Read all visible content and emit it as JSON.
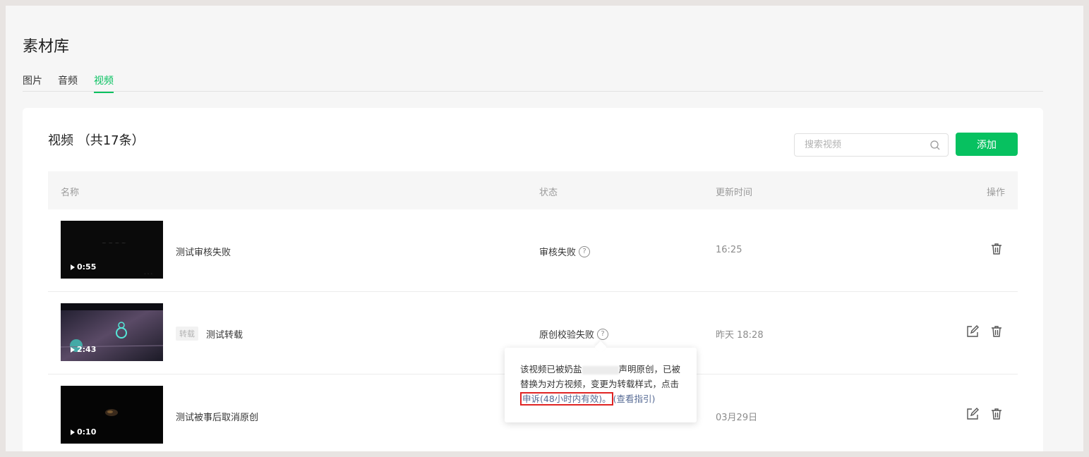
{
  "page": {
    "title": "素材库"
  },
  "tabs": [
    {
      "label": "图片",
      "active": false
    },
    {
      "label": "音频",
      "active": false
    },
    {
      "label": "视频",
      "active": true
    }
  ],
  "list": {
    "title": "视频 （共17条）",
    "search_placeholder": "搜索视频",
    "add_label": "添加",
    "columns": {
      "name": "名称",
      "status": "状态",
      "updated": "更新时间",
      "actions": "操作"
    }
  },
  "videos": [
    {
      "duration": "0:55",
      "tag": "",
      "name": "测试审核失败",
      "status": "审核失败",
      "updated": "16:25",
      "actions": [
        "delete-icon"
      ]
    },
    {
      "duration": "2:43",
      "tag": "转载",
      "name": "测试转载",
      "status": "原创校验失败",
      "updated": "昨天 18:28",
      "actions": [
        "edit-icon",
        "delete-icon"
      ]
    },
    {
      "duration": "0:10",
      "tag": "",
      "name": "测试被事后取消原创",
      "status": "",
      "updated": "03月29日",
      "actions": [
        "edit-icon",
        "delete-icon"
      ]
    }
  ],
  "tooltip": {
    "line1_a": "该视频已被奶盐",
    "line1_b": "声明原创，已被",
    "line2": "替换为对方视频，变更为转载样式，点击",
    "appeal": "申诉(48小时内有效)。",
    "guide": "(查看指引)"
  },
  "colors": {
    "accent": "#07c160",
    "link": "#576b95",
    "highlight_box": "#e02424"
  }
}
